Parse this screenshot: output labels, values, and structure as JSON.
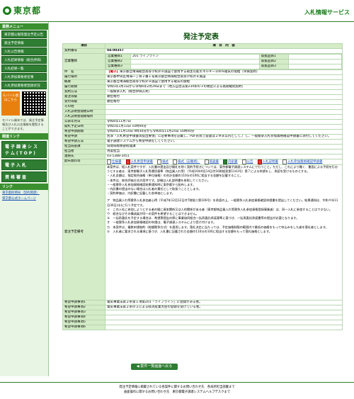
{
  "header": {
    "logo": "東京都",
    "site_title": "入札情報サービス"
  },
  "sidebar": {
    "head1": "業務メニュー",
    "menu": [
      "東京都公報等発注予定公告",
      "発注予定情報",
      "入札公告情報",
      "入札結果情報（総合評価）",
      "入札結果一覧",
      "入札参加資格者名簿",
      "入札参加資格者登録状況"
    ],
    "mobile_label": "モバイル版",
    "mobile_sub": "はこちら",
    "side_note": "モバイル端末では、発注予定情報及び入札公告情報を閲覧することができます。",
    "head2": "関連リンク",
    "big_links": [
      "電子調達システム(TOP)",
      "電子入札",
      "資格審査"
    ],
    "head3": "リンク",
    "links": [
      "東京都財務局（契約関連）",
      "東京都公式ホームページ"
    ]
  },
  "main": {
    "title": "発注予定表",
    "col_item": "項目",
    "col_content": "項　目　内　容",
    "rows": [
      {
        "label": "契約番号",
        "value": "04-00357"
      },
      {
        "label": "営業種目",
        "sub": [
          {
            "k": "営業種目1",
            "v": "201 ライフライン",
            "k2": "取扱品目1",
            "v2": ""
          },
          {
            "k": "営業種目2",
            "v": "",
            "k2": "取扱品目2",
            "v2": ""
          },
          {
            "k": "営業種目3",
            "v": "",
            "k2": "取扱品目3",
            "v2": ""
          }
        ]
      },
      {
        "label": "件　名",
        "tag": "【電子】",
        "value": "東京都立晴海総合高等学校外８施設で使用する再生可能エネルギー100%電気の需給（単価契約）"
      },
      {
        "label": "履行場所",
        "value": "東京都中央区晴海一丁目２番１号東京都立晴海総合高等学校外８施設"
      },
      {
        "label": "概要",
        "value": "東京都立晴海総合高等学校外８施設で使用する電気の需給"
      },
      {
        "label": "履行期間",
        "value": "令和5年3月1日から令和6年2月29日まで（地方自治法第234条の３の規定による長期継続契約）"
      },
      {
        "label": "契約方法",
        "value": "一般競争入札（総合評価方式）"
      },
      {
        "label": "発注等級",
        "value": "順位格付"
      },
      {
        "label": "受付等級",
        "value": "順位格付"
      },
      {
        "label": "その他",
        "value": ""
      },
      {
        "label": "入札説明会開催日時",
        "value": ""
      },
      {
        "label": "入札説明会開催場所",
        "value": ""
      },
      {
        "label": "公表年月日",
        "value": "令和4年11月7日"
      },
      {
        "label": "開札予定日時",
        "value": "令和5年1月13日 10時00分"
      },
      {
        "label": "希望申請期間",
        "value": "令和4年11月14日 9時30分から令和4年11月24日 16時00分"
      },
      {
        "label": "希望申請",
        "value": "別添「入札希望申請書等提出要領」に必要事項を記載し、PDF形式で容量は２ＭＢ以内として、）し、一般競争入札参加資格確認申請書に添付してください。"
      },
      {
        "label": "希望申請方法",
        "value": "電子調達システムから希望申請をしてください。"
      },
      {
        "label": "担当局部課",
        "value": "環境局総務部経理課"
      },
      {
        "label": "担当者",
        "value": "用度担当"
      },
      {
        "label": "連絡先",
        "value": "03-5388-3451"
      },
      {
        "label": "配布資料等",
        "docs": [
          "仕様書",
          "入札希望申請書",
          "様式",
          "様式（記載例）",
          "質疑書",
          "内訳書",
          "公告",
          "入札説明書",
          "入札参加資格確認申請書"
        ]
      }
    ],
    "notes_label": "発注予定備考",
    "notes": [
      "本案件は、紙入札案件ですが、入札書の提出及び開札を除く契約手続きについては、東京都電子調達システムにて行うこと。ただし、これにより難く、書面による手続を行おうとする者は、東京都電子入札等運用基準（物品買入れ等）（平成16年9月14日付16財経契第1143号）第７による申請をし、承認を受けるものとする。",
      "・入札金額は、指定総合価格（単位価格）の合計金額の110分の100に相当する金額を記載すること。",
      "・本件は、総合評価方式の案件です。詳細は入札説明書を参照してください。",
      "・一般競争入札参加資格確認結果通知時に東京都から配布します。",
      "・内訳書の提出のない場合は入札者の責任として取扱うこととします。",
      "・契約単価は、内訳書に記載した各単価とします。",
      "ア　物品買入れ等競争入札参加者心得（平成7年12月12日付7財経二第106号）を承認の上、一般競争入札参加資格確認申請書を提出してください。結果通知は、令和４年11月30日(水)に行う予定です。",
      "イ　この入札に参加しようとする者の間に資本関係又は人的関係がある者（東京都物品買入れ等競争入札参加資格登録事業者）は、同一入札に参加することはできない。",
      "ウ　総合なびその構成員が同一の案件を希望することはできません。",
      "エ　一括再委託を予定する場合は、希望票提出の際に事業協同組合一括再委託承諾基準に基づき、一括再委託承諾書等の提出が必要となります。",
      "オ　一般競争入札参加資格確認の申請は、電子調達システムにより受け付けます。",
      "カ　本案件は、複数申請制約（総額競争方式）を適用します。落札決定に当たっては、予定価格制限の範囲内で最低の価格をもって申込みをした者を落札者とします。",
      "キ　入札者に要求される事項に基づき、入札書に記載された金額の110分の100に相当する金額をもって落札価格とします。"
    ],
    "extra_rows": [
      {
        "label": "希望申請事項1",
        "value": "電気事業法第２条第１項第201「ライフライン」に登録がある者。"
      },
      {
        "label": "希望申請事項2",
        "value": "電気事業法第２条の２による経済産業大臣の登録を受けている者。"
      },
      {
        "label": "希望申請事項3",
        "value": ""
      },
      {
        "label": "希望申請事項4",
        "value": ""
      },
      {
        "label": "希望申請事項5",
        "value": ""
      },
      {
        "label": "希望申請事項6",
        "value": ""
      }
    ],
    "back_label": "◀ 案件一覧画面へ戻る"
  },
  "footer": {
    "line1": "発注予定情報に掲載されている各案件に関するお問い合わせ先　各局所担当部署まで",
    "line2": "画面操作に関するお問い合わせ先　東京都電子調達システムヘルプデスクまで"
  },
  "colors": {
    "accent": "#2e7d32",
    "label_bg": "#d5ecc8",
    "tag_red": "#cc0000"
  }
}
